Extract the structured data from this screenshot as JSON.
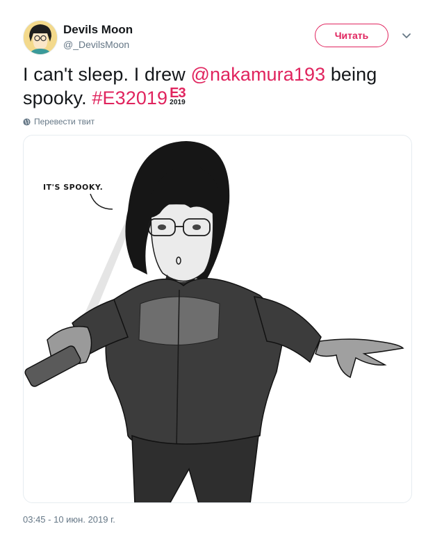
{
  "user": {
    "name": "Devils Moon",
    "handle": "@_DevilsMoon"
  },
  "follow_label": "Читать",
  "tweet": {
    "text_start": "I can't sleep. I drew ",
    "mention": "@nakamura193",
    "text_mid": " being spooky. ",
    "hashtag": "#E32019",
    "hashflag_logo": "E3",
    "hashflag_year": "2019"
  },
  "translate_label": "Перевести твит",
  "media": {
    "speech_bubble": "IT'S SPOOKY."
  },
  "timestamp": "03:45 - 10 июн. 2019 г.",
  "icons": {
    "globe": "globe-icon",
    "chevron": "chevron-down-icon"
  },
  "colors": {
    "accent": "#e0245e",
    "secondary_text": "#657786",
    "primary_text": "#14171a"
  }
}
